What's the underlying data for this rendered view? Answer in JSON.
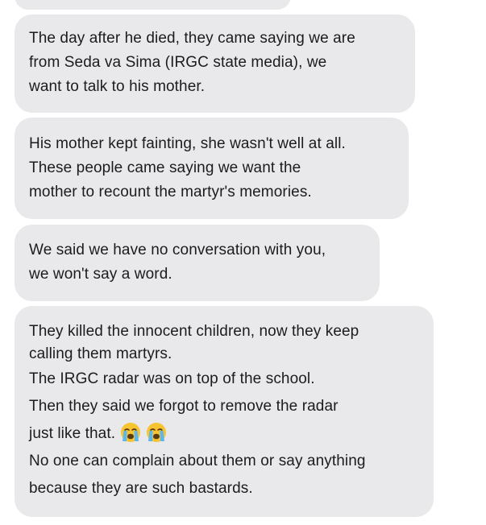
{
  "messages": [
    {
      "lines": [
        "The day after he died, they came saying we are",
        "from Seda va Sima (IRGC state media), we",
        "want to talk to his mother."
      ]
    },
    {
      "lines": [
        "His mother kept fainting, she wasn't well at all.",
        "These people came saying we want the",
        "mother to recount the martyr's memories."
      ]
    },
    {
      "lines": [
        "We said we have no conversation with you,",
        "we won't say a word."
      ]
    },
    {
      "lines": [
        "They killed the innocent children, now they keep",
        "calling them martyrs.",
        "The IRGC radar was on top of the school.",
        "Then they said we forgot to remove the radar",
        "just like that.",
        "No one can complain about them or say anything",
        "because they are such bastards."
      ],
      "emoji_after_line": 4,
      "emojis": [
        "crying-face-icon",
        "crying-face-icon"
      ]
    }
  ],
  "colors": {
    "bubble_bg": "#e9e9eb",
    "text": "#1c1c1e",
    "emoji_face": "#f7c531",
    "tears": "#5ab7f0"
  }
}
